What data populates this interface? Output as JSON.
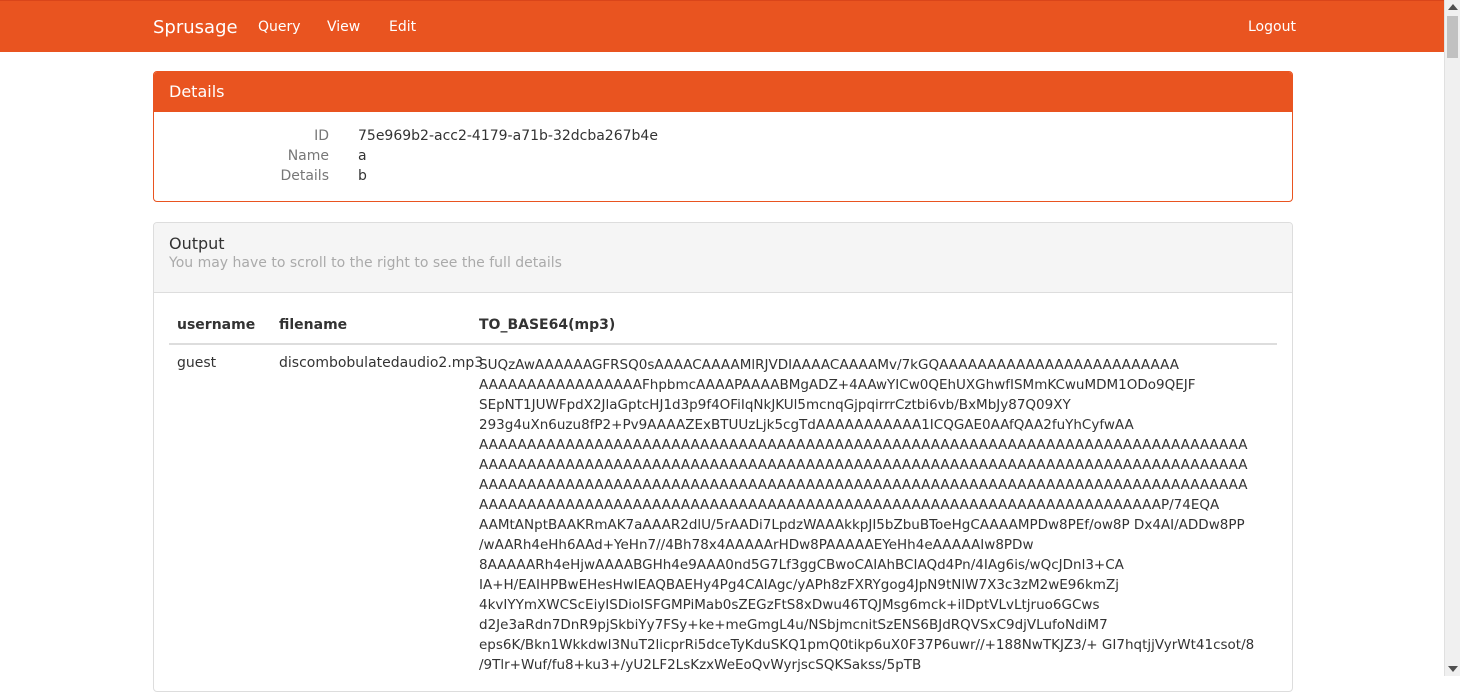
{
  "navbar": {
    "brand": "Sprusage",
    "menu": {
      "query": "Query",
      "view": "View",
      "edit": "Edit"
    },
    "logout": "Logout",
    "color": "#e95420"
  },
  "details": {
    "heading": "Details",
    "fields": [
      {
        "label": "ID",
        "value": "75e969b2-acc2-4179-a71b-32dcba267b4e"
      },
      {
        "label": "Name",
        "value": "a"
      },
      {
        "label": "Details",
        "value": "b"
      }
    ]
  },
  "output": {
    "heading": "Output",
    "subtitle": "You may have to scroll to the right to see the full details",
    "columns": [
      "username",
      "filename",
      "TO_BASE64(mp3)"
    ],
    "rows": [
      {
        "username": "guest",
        "filename": "discombobulatedaudio2.mp3",
        "mp3_lines": [
          "SUQzAwAAAAAAGFRSQ0sAAAACAAAAMlRJVDIAAAACAAAAMv/7kGQAAAAAAAAAAAAAAAAAAAAAAAAA",
          "AAAAAAAAAAAAAAAAAFhpbmcAAAAPAAAABMgADZ+4AAwYICw0QEhUXGhwfISMmKCwuMDM1ODo9QEJF",
          "SEpNT1JUWFpdX2JlaGptcHJ1d3p9f4OFiIqNkJKUl5mcnqGjpqirrrCztbi6vb/BxMbJy87Q09XY",
          "293g4uXn6uzu8fP2+Pv9AAAAZExBTUUzLjk5cgTdAAAAAAAAAAA1ICQGAE0AAfQAA2fuYhCyfwAA",
          "AAAAAAAAAAAAAAAAAAAAAAAAAAAAAAAAAAAAAAAAAAAAAAAAAAAAAAAAAAAAAAAAAAAAAAAAAAAAAAAA",
          "AAAAAAAAAAAAAAAAAAAAAAAAAAAAAAAAAAAAAAAAAAAAAAAAAAAAAAAAAAAAAAAAAAAAAAAAAAAAAAAA",
          "AAAAAAAAAAAAAAAAAAAAAAAAAAAAAAAAAAAAAAAAAAAAAAAAAAAAAAAAAAAAAAAAAAAAAAAAAAAAAAAA",
          "AAAAAAAAAAAAAAAAAAAAAAAAAAAAAAAAAAAAAAAAAAAAAAAAAAAAAAAAAAAAAAAAAAAAAAAP/74EQA",
          "AAMtANptBAAKRmAK7aAAAR2dlU/5rAADi7LpdzWAAAkkpJI5bZbuBToeHgCAAAAMPDw8PEf/ow8P Dx4AI/ADDw8PP",
          "/wAARh4eHh6AAd+YeHn7//4Bh78x4AAAAArHDw8PAAAAAEYeHh4eAAAAAIw8PDw",
          "8AAAAARh4eHjwAAAABGHh4e9AAA0nd5G7Lf3ggCBwoCAIAhBCIAQd4Pn/4IAg6is/wQcJDnl3+CA",
          "IA+H/EAIHPBwEHesHwIEAQBAEHy4Pg4CAIAgc/yAPh8zFXRYgog4JpN9tNlW7X3c3zM2wE96kmZj",
          "4kvIYYmXWCScEiyISDioISFGMPiMab0sZEGzFtS8xDwu46TQJMsg6mck+ilDptVLvLtjruo6GCws",
          "d2Je3aRdn7DnR9pjSkbiYy7FSy+ke+meGmgL4u/NSbjmcnitSzENS6BJdRQVSxC9djVLufoNdiM7",
          "eps6K/Bkn1Wkkdwl3NuT2licprRi5dceTyKduSKQ1pmQ0tikp6uX0F37P6uwr//+188NwTKJZ3/+ GI7hqtjjVyrWt41csot/8",
          "/9Tlr+Wuf/fu8+ku3+/yU2LF2LsKzxWeEoQvWyrjscSQKSakss/5pTB"
        ]
      }
    ]
  }
}
